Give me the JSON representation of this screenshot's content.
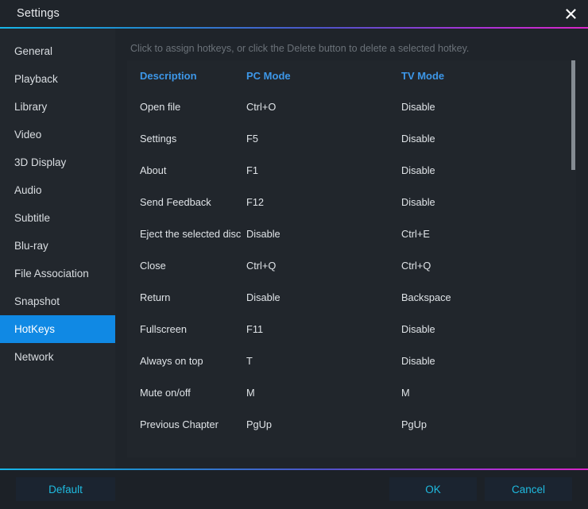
{
  "window": {
    "title": "Settings",
    "close_icon": "close-icon"
  },
  "sidebar": {
    "items": [
      {
        "label": "General",
        "active": false
      },
      {
        "label": "Playback",
        "active": false
      },
      {
        "label": "Library",
        "active": false
      },
      {
        "label": "Video",
        "active": false
      },
      {
        "label": "3D Display",
        "active": false
      },
      {
        "label": "Audio",
        "active": false
      },
      {
        "label": "Subtitle",
        "active": false
      },
      {
        "label": "Blu-ray",
        "active": false
      },
      {
        "label": "File Association",
        "active": false
      },
      {
        "label": "Snapshot",
        "active": false
      },
      {
        "label": "HotKeys",
        "active": true
      },
      {
        "label": "Network",
        "active": false
      }
    ]
  },
  "content": {
    "hint": "Click to assign hotkeys, or click the Delete button to delete a selected hotkey.",
    "table": {
      "headers": [
        "Description",
        "PC Mode",
        "TV Mode"
      ],
      "rows": [
        {
          "description": "Open file",
          "pc_mode": "Ctrl+O",
          "tv_mode": "Disable"
        },
        {
          "description": "Settings",
          "pc_mode": "F5",
          "tv_mode": "Disable"
        },
        {
          "description": "About",
          "pc_mode": "F1",
          "tv_mode": "Disable"
        },
        {
          "description": "Send Feedback",
          "pc_mode": "F12",
          "tv_mode": "Disable"
        },
        {
          "description": "Eject the selected disc",
          "pc_mode": "Disable",
          "tv_mode": "Ctrl+E"
        },
        {
          "description": "Close",
          "pc_mode": "Ctrl+Q",
          "tv_mode": "Ctrl+Q"
        },
        {
          "description": "Return",
          "pc_mode": "Disable",
          "tv_mode": "Backspace"
        },
        {
          "description": "Fullscreen",
          "pc_mode": "F11",
          "tv_mode": "Disable"
        },
        {
          "description": "Always on top",
          "pc_mode": "T",
          "tv_mode": "Disable"
        },
        {
          "description": "Mute on/off",
          "pc_mode": "M",
          "tv_mode": "M"
        },
        {
          "description": "Previous Chapter",
          "pc_mode": "PgUp",
          "tv_mode": "PgUp"
        }
      ]
    }
  },
  "footer": {
    "default_label": "Default",
    "ok_label": "OK",
    "cancel_label": "Cancel"
  },
  "colors": {
    "accent_blue": "#1089e4",
    "header_blue": "#3d97e8",
    "button_cyan": "#1fbbe0",
    "window_bg": "#1f242a",
    "sidebar_bg": "#22272d",
    "panel_bg": "#21262c",
    "footer_bg": "#1c2127",
    "hint_text": "#6b7279",
    "gradient_start": "#17b6e8",
    "gradient_end": "#d926c7",
    "scrollbar_thumb": "#858c93"
  }
}
